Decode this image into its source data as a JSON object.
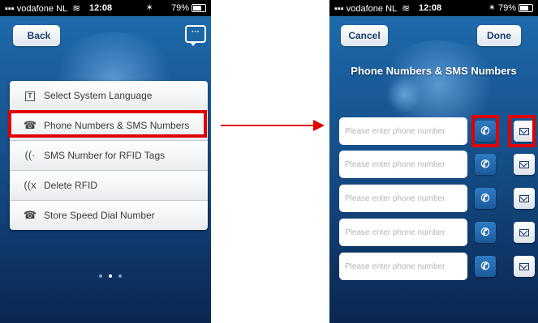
{
  "left_screen": {
    "status": {
      "carrier": "vodafone NL",
      "time": "12:08",
      "battery": "79%"
    },
    "back_label": "Back",
    "chat_icon_text": "···",
    "menu": [
      {
        "icon": "T",
        "label": "Select System Language"
      },
      {
        "icon": "☎",
        "label": "Phone Numbers & SMS Numbers"
      },
      {
        "icon": "((·",
        "label": "SMS Number for RFID Tags"
      },
      {
        "icon": "((x",
        "label": "Delete RFID"
      },
      {
        "icon": "☎",
        "label": "Store Speed Dial Number"
      }
    ]
  },
  "right_screen": {
    "status": {
      "carrier": "vodafone NL",
      "time": "12:08",
      "battery": "79%"
    },
    "cancel_label": "Cancel",
    "done_label": "Done",
    "title": "Phone Numbers & SMS Numbers",
    "rows": [
      {
        "placeholder": "Please enter phone number"
      },
      {
        "placeholder": "Please enter phone number"
      },
      {
        "placeholder": "Please enter phone number"
      },
      {
        "placeholder": "Please enter phone number"
      },
      {
        "placeholder": "Please enter phone number"
      }
    ],
    "call_icon": "✆"
  },
  "colors": {
    "highlight": "#e00000",
    "screen_bg": "#1a5c9a"
  },
  "pager": {
    "pages": 3,
    "active": 2
  }
}
